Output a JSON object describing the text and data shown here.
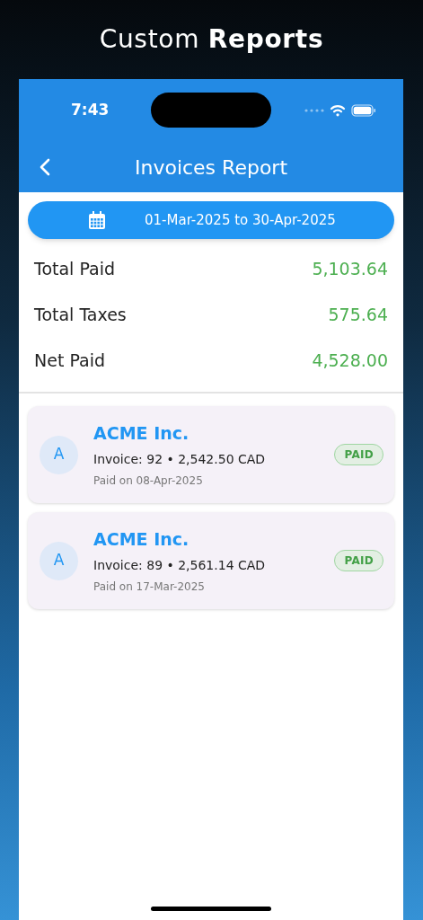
{
  "banner_title": "Custom **Reports**",
  "status_bar": {
    "time": "7:43"
  },
  "header": {
    "title": "Invoices Report"
  },
  "date_range": "01-Mar-2025 to 30-Apr-2025",
  "summary": [
    {
      "label": "Total Paid",
      "value": "5,103.64"
    },
    {
      "label": "Total Taxes",
      "value": "575.64"
    },
    {
      "label": "Net Paid",
      "value": "4,528.00"
    }
  ],
  "invoices": [
    {
      "avatar": "A",
      "customer": "ACME Inc.",
      "details": "Invoice: 92 • 2,542.50 CAD",
      "paid_on": "Paid on 08-Apr-2025",
      "status": "PAID"
    },
    {
      "avatar": "A",
      "customer": "ACME Inc.",
      "details": "Invoice: 89 • 2,561.14 CAD",
      "paid_on": "Paid on 17-Mar-2025",
      "status": "PAID"
    }
  ]
}
